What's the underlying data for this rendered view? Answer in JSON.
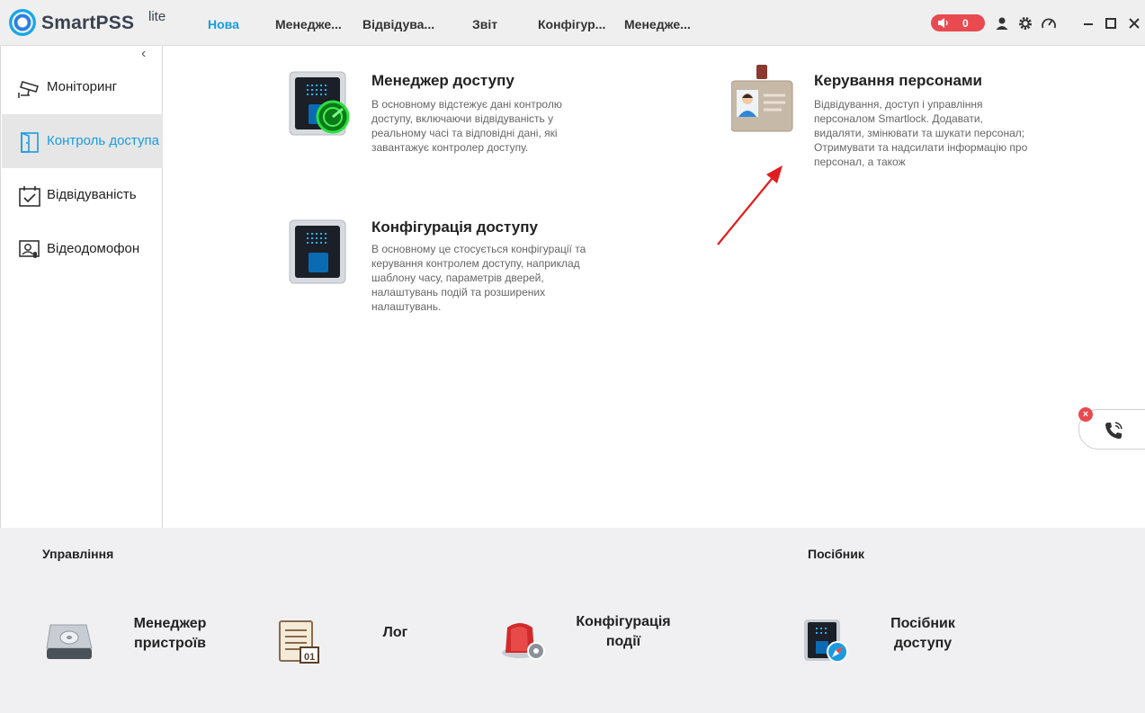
{
  "app": {
    "brand": "SmartPSS",
    "brand_suffix": "lite",
    "accent_color": "#1a9be0"
  },
  "nav": {
    "items": [
      {
        "label": "Нова",
        "active": true
      },
      {
        "label": "Менедже..."
      },
      {
        "label": "Відвідува..."
      },
      {
        "label": "Звіт"
      },
      {
        "label": "Конфігур..."
      },
      {
        "label": "Менедже..."
      }
    ]
  },
  "topbar": {
    "alarm_count": "0",
    "icons": [
      "speaker-icon",
      "user-icon",
      "gear-icon",
      "speed-icon",
      "minimize-icon",
      "maximize-icon",
      "close-icon"
    ]
  },
  "sidebar": {
    "items": [
      {
        "label": "Моніторинг",
        "icon": "cctv-camera-icon"
      },
      {
        "label": "Контроль доступа",
        "icon": "door-icon",
        "active": true
      },
      {
        "label": "Відвідуваність",
        "icon": "calendar-check-icon"
      },
      {
        "label": "Відеодомофон",
        "icon": "intercom-icon"
      }
    ]
  },
  "modules": [
    {
      "title": "Менеджер доступу",
      "description": "В основному відстежує дані контролю доступу, включаючи відвідуваність у реальному часі та відповідні дані, які завантажує контролер доступу."
    },
    {
      "title": "Керування персонами",
      "description": "Відвідування, доступ і управління персоналом Smartlock. Додавати, видаляти, змінювати та шукати персонал; Отримувати та надсилати інформацію про персонал, а також"
    },
    {
      "title": "Конфігурація доступу",
      "description": "В основному це стосується конфігурації та керування контролем доступу, наприклад шаблону часу, параметрів дверей, налаштувань подій та розширених налаштувань."
    }
  ],
  "bottom": {
    "management_title": "Управління",
    "guide_title": "Посібник",
    "tools": [
      {
        "label_line1": "Менеджер",
        "label_line2": "пристроїв"
      },
      {
        "label_line1": "Лог",
        "label_line2": ""
      },
      {
        "label_line1": "Конфігурація",
        "label_line2": "події"
      }
    ],
    "guide_tools": [
      {
        "label_line1": "Посібник",
        "label_line2": "доступу"
      }
    ],
    "log_icon_date": "01"
  },
  "callwidget": {
    "close_symbol": "×"
  }
}
